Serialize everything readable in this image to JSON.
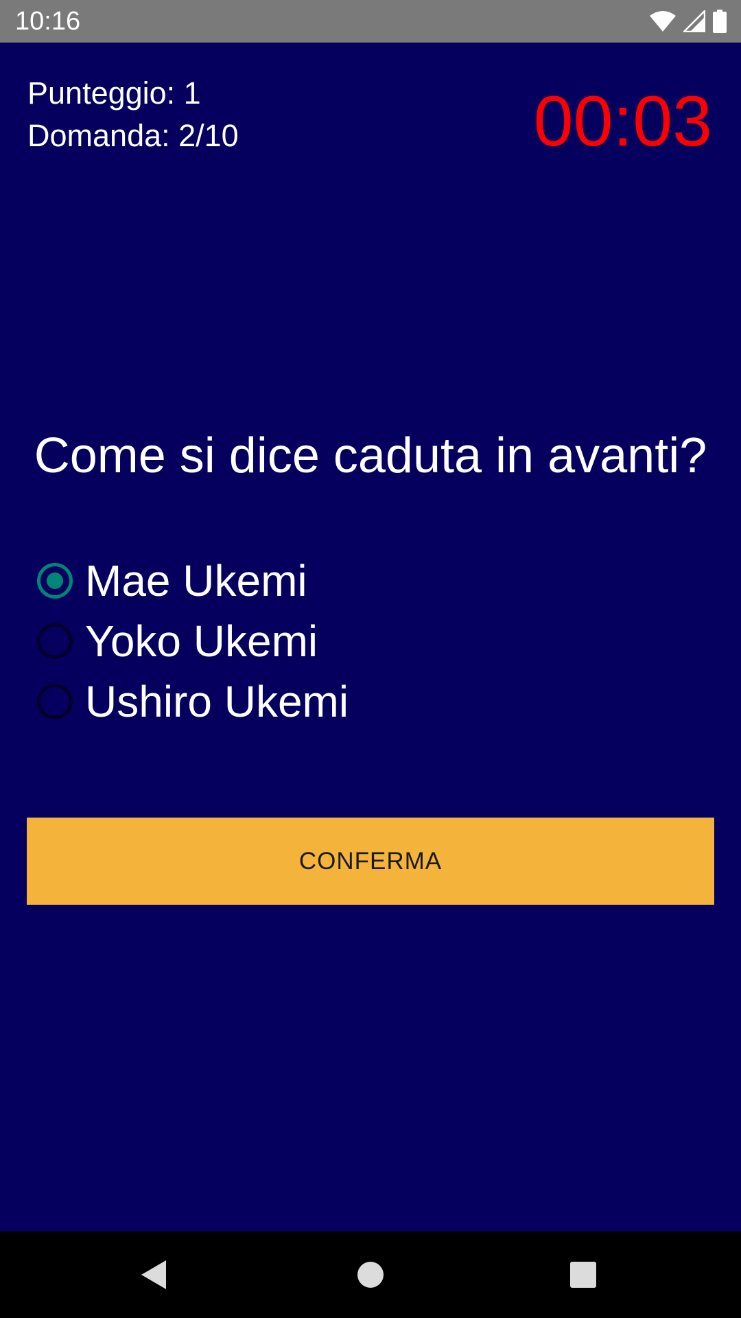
{
  "status_bar": {
    "time": "10:16",
    "icons": [
      "wifi-icon",
      "cell-signal-icon",
      "battery-icon"
    ]
  },
  "quiz": {
    "score": "Punteggio: 1",
    "question_count": "Domanda: 2/10",
    "timer": "00:03",
    "question": "Come si dice caduta in avanti?",
    "options": [
      {
        "label": "Mae Ukemi",
        "selected": true
      },
      {
        "label": "Yoko Ukemi",
        "selected": false
      },
      {
        "label": "Ushiro Ukemi",
        "selected": false
      }
    ],
    "confirm_label": "CONFERMA"
  },
  "nav_bar": {
    "icons": [
      "back-icon",
      "home-icon",
      "recents-icon"
    ]
  },
  "colors": {
    "background": "#05005e",
    "status_bar": "#7a7a7a",
    "timer": "#ff0000",
    "accent": "#008577",
    "button": "#f4b43c",
    "nav_bar": "#000000"
  }
}
